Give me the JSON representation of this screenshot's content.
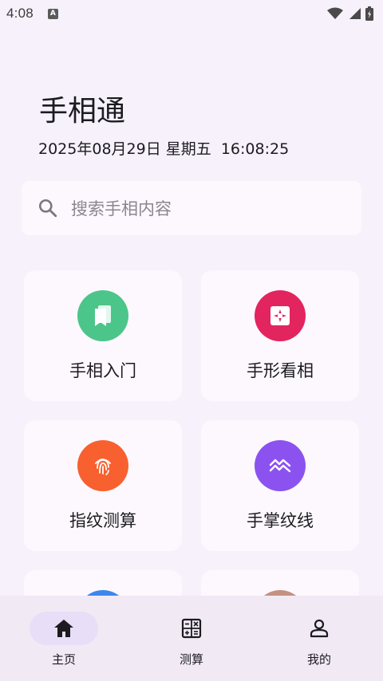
{
  "status_bar": {
    "time": "4:08",
    "notification_badge": "A"
  },
  "header": {
    "title": "手相通",
    "datetime": "2025年08月29日 星期五  16:08:25"
  },
  "search": {
    "placeholder": "搜索手相内容"
  },
  "cards": [
    {
      "label": "手相入门",
      "icon": "book-icon",
      "color": "#4cc58a"
    },
    {
      "label": "手形看相",
      "icon": "palm-shape-icon",
      "color": "#e2245f"
    },
    {
      "label": "指纹测算",
      "icon": "fingerprint-icon",
      "color": "#f8602f"
    },
    {
      "label": "手掌纹线",
      "icon": "palm-lines-icon",
      "color": "#8c52f0"
    },
    {
      "label": "",
      "icon": "partial-card-icon",
      "color": "#3d86ee"
    },
    {
      "label": "",
      "icon": "partial-card-icon",
      "color": "#c49182"
    }
  ],
  "bottom_nav": {
    "items": [
      {
        "label": "主页",
        "icon": "home-icon",
        "selected": true
      },
      {
        "label": "测算",
        "icon": "calculator-icon",
        "selected": false
      },
      {
        "label": "我的",
        "icon": "person-icon",
        "selected": false
      }
    ]
  }
}
